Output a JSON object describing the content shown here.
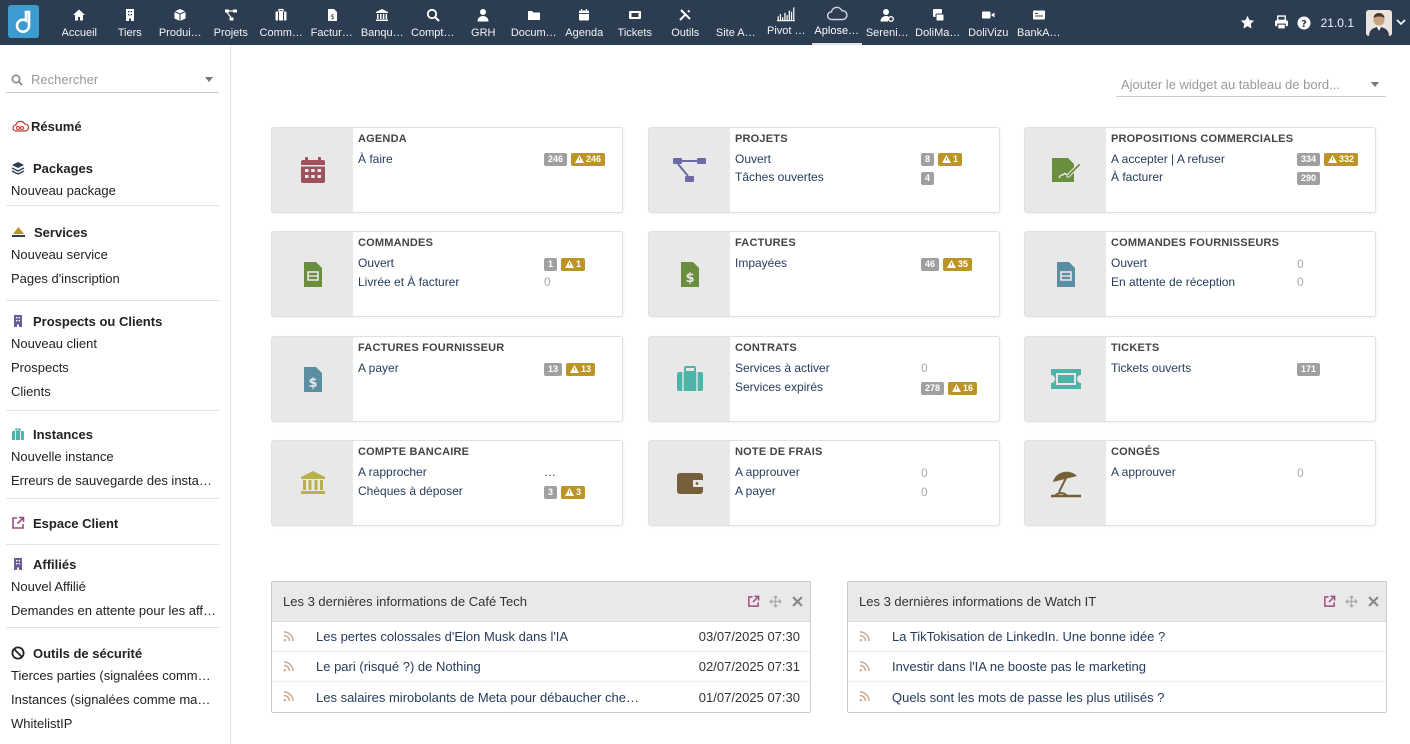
{
  "topbar": {
    "menus": [
      {
        "label": "Accueil",
        "icon": "home-icon"
      },
      {
        "label": "Tiers",
        "icon": "building-icon"
      },
      {
        "label": "Produi…",
        "icon": "cube-icon"
      },
      {
        "label": "Projets",
        "icon": "project-icon"
      },
      {
        "label": "Comm…",
        "icon": "briefcase-icon"
      },
      {
        "label": "Factur…",
        "icon": "invoice-icon"
      },
      {
        "label": "Banqu…",
        "icon": "bank-icon"
      },
      {
        "label": "Compt…",
        "icon": "search-money-icon"
      },
      {
        "label": "GRH",
        "icon": "user-tie-icon"
      },
      {
        "label": "Docum…",
        "icon": "folder-icon"
      },
      {
        "label": "Agenda",
        "icon": "calendar-icon"
      },
      {
        "label": "Tickets",
        "icon": "ticket-icon"
      },
      {
        "label": "Outils",
        "icon": "tools-icon"
      },
      {
        "label": "Site A…",
        "icon": "blank-icon"
      },
      {
        "label": "Pivot …",
        "icon": "chart-icon"
      },
      {
        "label": "Aplose…",
        "icon": "cloud-icon"
      },
      {
        "label": "Sereni…",
        "icon": "user-gear-icon"
      },
      {
        "label": "DoliMa…",
        "icon": "user-card-icon"
      },
      {
        "label": "DoliVizu",
        "icon": "video-icon"
      },
      {
        "label": "BankA…",
        "icon": "money-card-icon"
      }
    ],
    "version": "21.0.1",
    "accent": "#2c3d52"
  },
  "sidebar": {
    "search_placeholder": "Rechercher",
    "resume": "Résumé",
    "packages": {
      "title": "Packages",
      "items": [
        "Nouveau package"
      ]
    },
    "services": {
      "title": "Services",
      "items": [
        "Nouveau service",
        "Pages d'inscription"
      ]
    },
    "prospects": {
      "title": "Prospects ou Clients",
      "items": [
        "Nouveau client",
        "Prospects",
        "Clients"
      ]
    },
    "instances": {
      "title": "Instances",
      "items": [
        "Nouvelle instance",
        "Erreurs de sauvegarde des insta…"
      ]
    },
    "espace": {
      "title": "Espace Client"
    },
    "affilies": {
      "title": "Affiliés",
      "items": [
        "Nouvel Affilié",
        "Demandes en attente pour les aff…"
      ]
    },
    "securite": {
      "title": "Outils de sécurité",
      "items": [
        "Tierces parties (signalées comm…",
        "Instances (signalées comme ma…",
        "WhitelistIP"
      ]
    }
  },
  "widget_select": "Ajouter le widget au tableau de bord...",
  "boxes": {
    "agenda": {
      "title": "AGENDA",
      "l1": "À faire",
      "b1": "246",
      "w1": "246"
    },
    "projets": {
      "title": "PROJETS",
      "l1": "Ouvert",
      "b1": "8",
      "w1": "1",
      "l2": "Tâches ouvertes",
      "b2": "4"
    },
    "propal": {
      "title": "PROPOSITIONS COMMERCIALES",
      "l1": "A accepter | A refuser",
      "b1": "334",
      "w1": "332",
      "l2": "À facturer",
      "b2": "290"
    },
    "commandes": {
      "title": "COMMANDES",
      "l1": "Ouvert",
      "b1": "1",
      "w1": "1",
      "l2": "Livrée et À facturer",
      "z2": "0"
    },
    "factures": {
      "title": "FACTURES",
      "l1": "Impayées",
      "b1": "46",
      "w1": "35"
    },
    "cmdfourn": {
      "title": "COMMANDES FOURNISSEURS",
      "l1": "Ouvert",
      "z1": "0",
      "l2": "En attente de réception",
      "z2": "0"
    },
    "factfourn": {
      "title": "FACTURES FOURNISSEUR",
      "l1": "A payer",
      "b1": "13",
      "w1": "13"
    },
    "contrats": {
      "title": "CONTRATS",
      "l1": "Services à activer",
      "z1": "0",
      "l2": "Services expirés",
      "b2": "278",
      "w2": "16"
    },
    "tickets": {
      "title": "TICKETS",
      "l1": "Tickets ouverts",
      "b1": "171"
    },
    "banque": {
      "title": "COMPTE BANCAIRE",
      "l1": "A rapprocher",
      "z1": "…",
      "l2": "Chèques à déposer",
      "b2": "3",
      "w2": "3"
    },
    "frais": {
      "title": "NOTE DE FRAIS",
      "l1": "A approuver",
      "z1": "0",
      "l2": "A payer",
      "z2": "0"
    },
    "conges": {
      "title": "CONGÉS",
      "l1": "A approuver",
      "z1": "0"
    }
  },
  "rss1": {
    "title": "Les 3 dernières informations de Café Tech",
    "rows": [
      {
        "t": "Les pertes colossales d'Elon Musk dans l'IA",
        "d": "03/07/2025 07:30"
      },
      {
        "t": "Le pari (risqué ?) de Nothing",
        "d": "02/07/2025 07:31"
      },
      {
        "t": "Les salaires mirobolants de Meta pour débaucher che…",
        "d": "01/07/2025 07:30"
      }
    ]
  },
  "rss2": {
    "title": "Les 3 dernières informations de Watch IT",
    "rows": [
      {
        "t": "La TikTokisation de LinkedIn. Une bonne idée ?"
      },
      {
        "t": "Investir dans l'IA ne booste pas le marketing"
      },
      {
        "t": "Quels sont les mots de passe les plus utilisés ?"
      }
    ]
  }
}
